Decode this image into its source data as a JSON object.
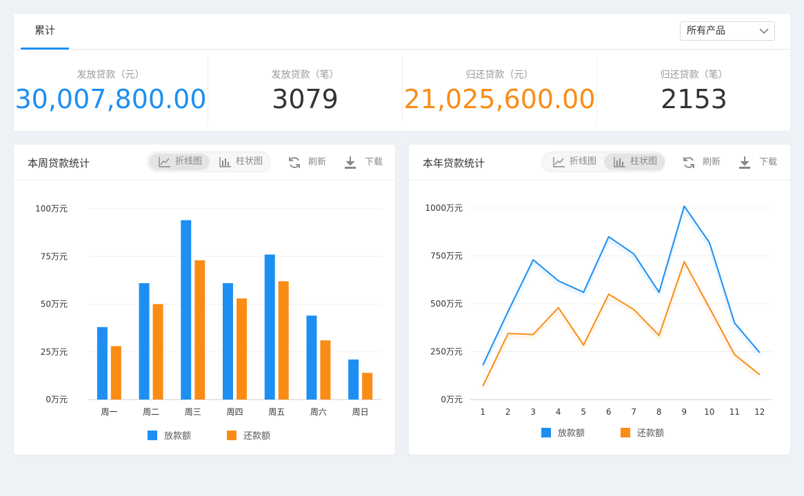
{
  "summary": {
    "tab": "累计",
    "filter_selected": "所有产品",
    "stats": [
      {
        "label": "发放贷款（元）",
        "value": "30,007,800.00",
        "color": "#1e8ff2"
      },
      {
        "label": "发放贷款（笔）",
        "value": "3079",
        "color": "#333333"
      },
      {
        "label": "归还贷款（元）",
        "value": "21,025,600.00",
        "color": "#fa8c16"
      },
      {
        "label": "归还贷款（笔）",
        "value": "2153",
        "color": "#333333"
      }
    ]
  },
  "controls": {
    "line_label": "折线图",
    "bar_label": "柱状图",
    "refresh_label": "刷新",
    "download_label": "下载"
  },
  "colors": {
    "blue": "#1e8ff2",
    "orange": "#fa8c16"
  },
  "chart_data": [
    {
      "title": "本周贷款统计",
      "type": "bar",
      "active_view": "bar",
      "categories": [
        "周一",
        "周二",
        "周三",
        "周四",
        "周五",
        "周六",
        "周日"
      ],
      "y_ticks": [
        "0万元",
        "25万元",
        "50万元",
        "75万元",
        "100万元"
      ],
      "ylim": [
        0,
        100
      ],
      "series": [
        {
          "name": "放款额",
          "color": "#1e8ff2",
          "values": [
            38,
            61,
            94,
            61,
            76,
            44,
            21
          ]
        },
        {
          "name": "还款额",
          "color": "#fa8c16",
          "values": [
            28,
            50,
            73,
            53,
            62,
            31,
            14
          ]
        }
      ],
      "legend": "bottom"
    },
    {
      "title": "本年贷款统计",
      "type": "line",
      "active_view": "line",
      "categories": [
        "1",
        "2",
        "3",
        "4",
        "5",
        "6",
        "7",
        "8",
        "9",
        "10",
        "11",
        "12"
      ],
      "y_ticks": [
        "0万元",
        "250万元",
        "500万元",
        "750万元",
        "1000万元"
      ],
      "ylim": [
        0,
        1000
      ],
      "series": [
        {
          "name": "放款额",
          "color": "#1e8ff2",
          "values": [
            180,
            460,
            730,
            620,
            560,
            850,
            760,
            560,
            1010,
            820,
            400,
            245
          ]
        },
        {
          "name": "还款额",
          "color": "#fa8c16",
          "values": [
            70,
            345,
            340,
            480,
            285,
            550,
            470,
            335,
            720,
            480,
            235,
            130
          ]
        }
      ],
      "legend": "bottom"
    }
  ]
}
